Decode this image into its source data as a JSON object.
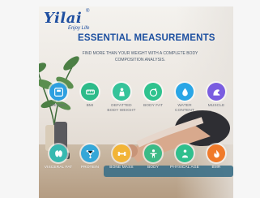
{
  "brand": {
    "logo_text": "Yilai",
    "logo_sub": "Enjoy Life",
    "registered": "®"
  },
  "hero": {
    "title": "ESSENTIAL MEASUREMENTS",
    "subtitle": "FIND MORE THAN YOUR WEIGHT WITH A COMPLETE BODY COMPOSITION ANALYSIS."
  },
  "features_row1": [
    {
      "label": "WEIGHT",
      "icon": "scale-icon",
      "color": "#2e9fe0"
    },
    {
      "label": "BMI",
      "icon": "bmi-icon",
      "color": "#2dbb8a"
    },
    {
      "label": "DEFATTED BODY WEIGHT",
      "icon": "person-icon",
      "color": "#35c39a"
    },
    {
      "label": "BODY FAT",
      "icon": "fat-icon",
      "color": "#2fc28e"
    },
    {
      "label": "WATER CONTENT",
      "icon": "water-drop-icon",
      "color": "#2aa6e6"
    },
    {
      "label": "MUSCLE",
      "icon": "muscle-icon",
      "color": "#7a5de0"
    }
  ],
  "features_row2": [
    {
      "label": "VISCERAL FAT",
      "icon": "organ-icon",
      "color": "#38b9b0"
    },
    {
      "label": "PROTEIN",
      "icon": "molecule-icon",
      "color": "#35a7d8"
    },
    {
      "label": "BONE MASS",
      "icon": "bone-icon",
      "color": "#f2b437"
    },
    {
      "label": "BODY",
      "icon": "body-icon",
      "color": "#3dba86"
    },
    {
      "label": "PHYSICAL AGE",
      "icon": "age-icon",
      "color": "#2fbf8d"
    },
    {
      "label": "BMR",
      "icon": "flame-icon",
      "color": "#f07a2a"
    }
  ]
}
